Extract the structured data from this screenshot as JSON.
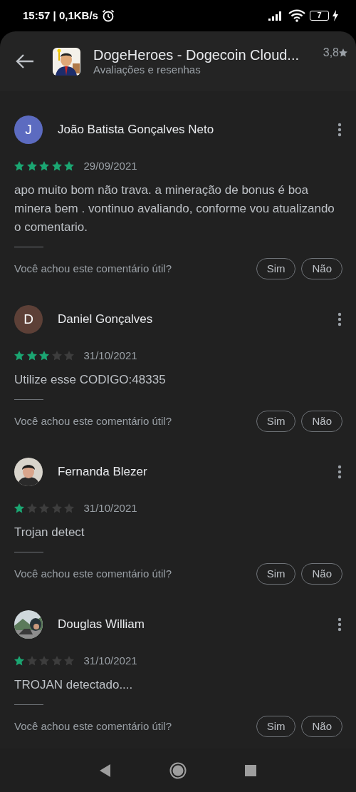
{
  "status_bar": {
    "time": "15:57 | 0,1KB/s",
    "battery": "7"
  },
  "header": {
    "title": "DogeHeroes - Dogecoin Cloud...",
    "subtitle": "Avaliações e resenhas",
    "rating": "3,8"
  },
  "reviews": [
    {
      "author": "João Batista Gonçalves Neto",
      "avatar": {
        "kind": "letter",
        "letter": "J",
        "color": "#5c6bc0"
      },
      "stars": 5,
      "date": "29/09/2021",
      "text": "apo muito bom não trava. a mineração de bonus é boa minera bem . vontinuo avaliando, conforme vou atualizando o comentario.",
      "helpful_prompt": "Você achou este comentário útil?",
      "yes": "Sim",
      "no": "Não"
    },
    {
      "author": "Daniel Gonçalves",
      "avatar": {
        "kind": "letter",
        "letter": "D",
        "color": "#5d4037"
      },
      "stars": 3,
      "date": "31/10/2021",
      "text": "Utilize esse CODIGO:48335",
      "helpful_prompt": "Você achou este comentário útil?",
      "yes": "Sim",
      "no": "Não"
    },
    {
      "author": "Fernanda Blezer",
      "stars": 1,
      "date": "31/10/2021",
      "text": "Trojan detect",
      "helpful_prompt": "Você achou este comentário útil?",
      "yes": "Sim",
      "no": "Não"
    },
    {
      "author": "Douglas William",
      "stars": 1,
      "date": "31/10/2021",
      "text": "TROJAN detectado....",
      "helpful_prompt": "Você achou este comentário útil?",
      "yes": "Sim",
      "no": "Não"
    }
  ]
}
